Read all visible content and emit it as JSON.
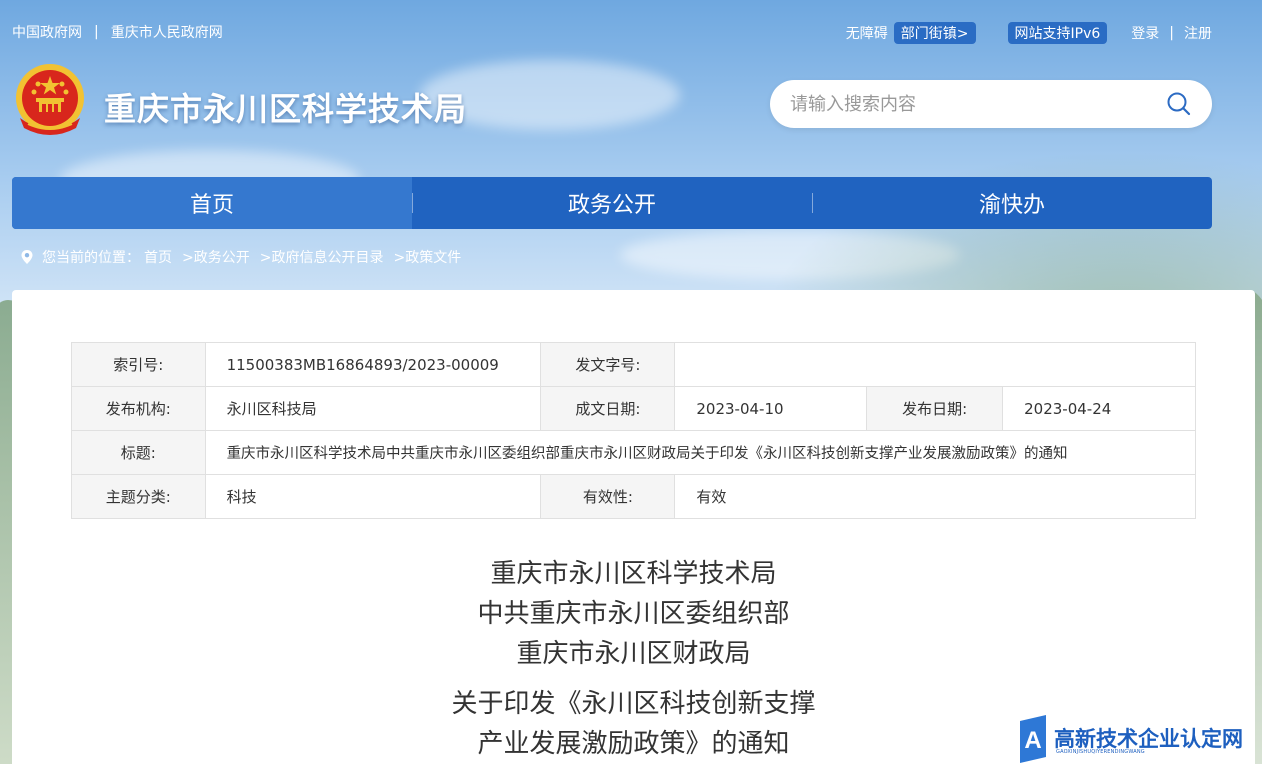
{
  "topbar": {
    "left_links": [
      "中国政府网",
      "重庆市人民政府网"
    ],
    "separator": "|",
    "accessibility": "无障碍",
    "dept_pill": "部门街镇>",
    "ipv6_pill": "网站支持IPv6",
    "login": "登录",
    "register": "注册"
  },
  "header": {
    "site_title": "重庆市永川区科学技术局",
    "search_placeholder": "请输入搜索内容"
  },
  "nav": {
    "items": [
      {
        "label": "首页",
        "active": true
      },
      {
        "label": "政务公开",
        "active": false
      },
      {
        "label": "渝快办",
        "active": false
      }
    ]
  },
  "breadcrumb": {
    "prefix": "您当前的位置：",
    "items": [
      "首页",
      ">政务公开",
      ">政府信息公开目录",
      ">政策文件"
    ]
  },
  "meta": {
    "index_label": "索引号:",
    "index_value": "11500383MB16864893/2023-00009",
    "docno_label": "发文字号:",
    "docno_value": "",
    "org_label": "发布机构:",
    "org_value": "永川区科技局",
    "created_label": "成文日期:",
    "created_value": "2023-04-10",
    "published_label": "发布日期:",
    "published_value": "2023-04-24",
    "title_label": "标题:",
    "title_value": "重庆市永川区科学技术局中共重庆市永川区委组织部重庆市永川区财政局关于印发《永川区科技创新支撑产业发展激励政策》的通知",
    "topic_label": "主题分类:",
    "topic_value": "科技",
    "validity_label": "有效性:",
    "validity_value": "有效"
  },
  "document": {
    "issuers": [
      "重庆市永川区科学技术局",
      "中共重庆市永川区委组织部",
      "重庆市永川区财政局"
    ],
    "subject_lines": [
      "关于印发《永川区科技创新支撑",
      "产业发展激励政策》的通知"
    ]
  },
  "watermark": {
    "text": "高新技术企业认定网",
    "sub": "GAOXINJISHUQIYERENDINGWANG"
  },
  "colors": {
    "nav_bg": "#2063c0",
    "nav_active": "#3578cf",
    "pill_bg": "#2a6cc4",
    "emblem_red": "#d8261c",
    "emblem_gold": "#f2c232"
  }
}
